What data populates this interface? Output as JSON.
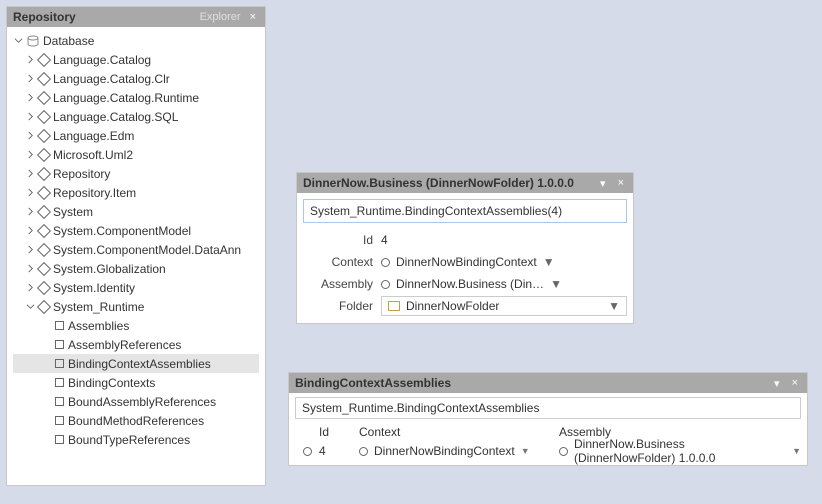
{
  "repo": {
    "title": "Repository",
    "aux": "Explorer",
    "root": "Database",
    "nodes": [
      "Language.Catalog",
      "Language.Catalog.Clr",
      "Language.Catalog.Runtime",
      "Language.Catalog.SQL",
      "Language.Edm",
      "Microsoft.Uml2",
      "Repository",
      "Repository.Item",
      "System",
      "System.ComponentModel",
      "System.ComponentModel.DataAnn",
      "System.Globalization",
      "System.Identity"
    ],
    "expanded": "System_Runtime",
    "children": [
      "Assemblies",
      "AssemblyReferences",
      "BindingContextAssemblies",
      "BindingContexts",
      "BoundAssemblyReferences",
      "BoundMethodReferences",
      "BoundTypeReferences"
    ],
    "selected": "BindingContextAssemblies"
  },
  "detail": {
    "title": "DinnerNow.Business (DinnerNowFolder) 1.0.0.0",
    "path": "System_Runtime.BindingContextAssemblies(4)",
    "fields": {
      "id_label": "Id",
      "id_value": "4",
      "context_label": "Context",
      "context_value": "DinnerNowBindingContext",
      "assembly_label": "Assembly",
      "assembly_value": "DinnerNow.Business (Din…",
      "folder_label": "Folder",
      "folder_value": "DinnerNowFolder"
    }
  },
  "list": {
    "title": "BindingContextAssemblies",
    "path": "System_Runtime.BindingContextAssemblies",
    "cols": {
      "id": "Id",
      "context": "Context",
      "assembly": "Assembly"
    },
    "row": {
      "id": "4",
      "context": "DinnerNowBindingContext",
      "assembly": "DinnerNow.Business (DinnerNowFolder) 1.0.0.0"
    }
  }
}
